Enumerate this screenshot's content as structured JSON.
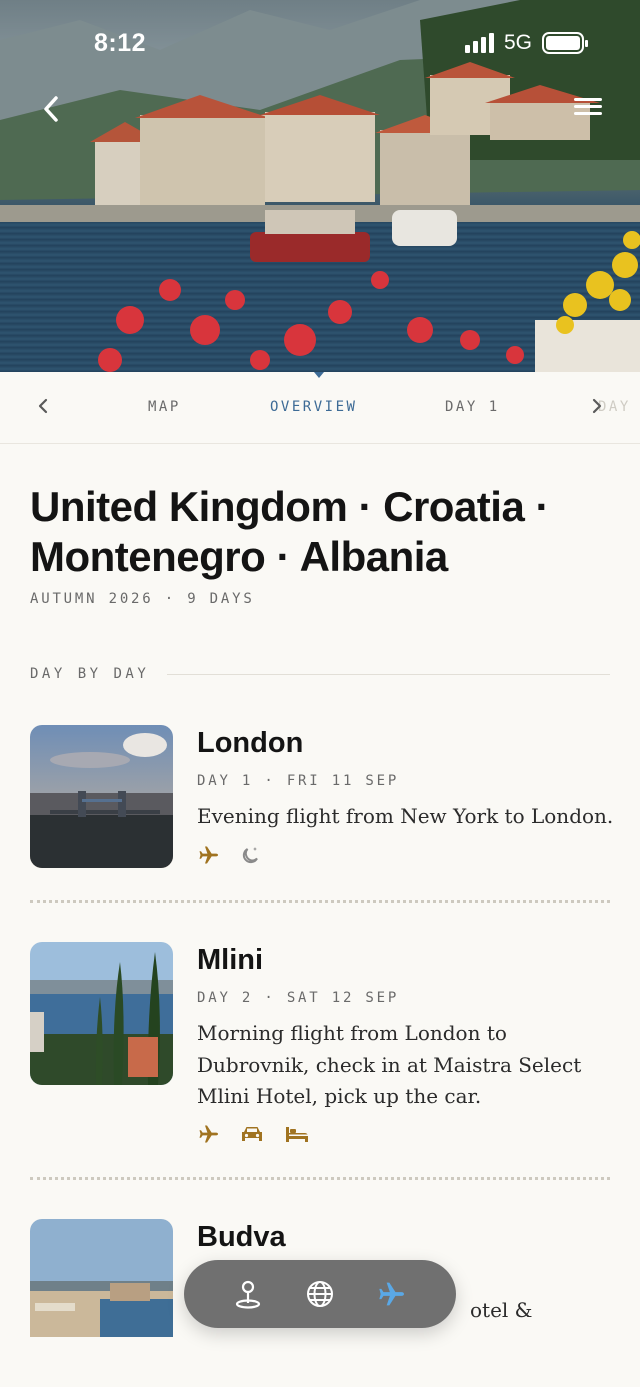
{
  "status_bar": {
    "time": "8:12",
    "network": "5G"
  },
  "hero": {
    "back_icon": "chevron-left-icon",
    "menu_icon": "hamburger-icon"
  },
  "tabs": {
    "items": [
      {
        "label": "MAP",
        "active": false
      },
      {
        "label": "OVERVIEW",
        "active": true
      },
      {
        "label": "DAY 1",
        "active": false
      }
    ],
    "next_peek": "DAY"
  },
  "trip": {
    "title": "United Kingdom · Croatia · Montenegro · Albania",
    "meta": "AUTUMN 2026 · 9 DAYS",
    "section_label": "DAY BY DAY"
  },
  "days": [
    {
      "name": "London",
      "meta": "DAY 1 · FRI 11 SEP",
      "description": "Evening flight from New York to London.",
      "icons": [
        "plane-icon",
        "moon-icon"
      ]
    },
    {
      "name": "Mlini",
      "meta": "DAY 2 · SAT 12 SEP",
      "description": "Morning flight from London to Dubrovnik, check in at Maistra Select Mlini Hotel, pick up the car.",
      "icons": [
        "plane-icon",
        "car-icon",
        "bed-icon"
      ]
    },
    {
      "name": "Budva",
      "partial_text": "otel &"
    }
  ],
  "colors": {
    "accent": "#3d6b96",
    "icon_gold": "#a07320",
    "background": "#faf9f5"
  },
  "float_nav": {
    "items": [
      "map-pin-icon",
      "globe-icon",
      "plane-icon"
    ],
    "active": "plane-icon"
  }
}
